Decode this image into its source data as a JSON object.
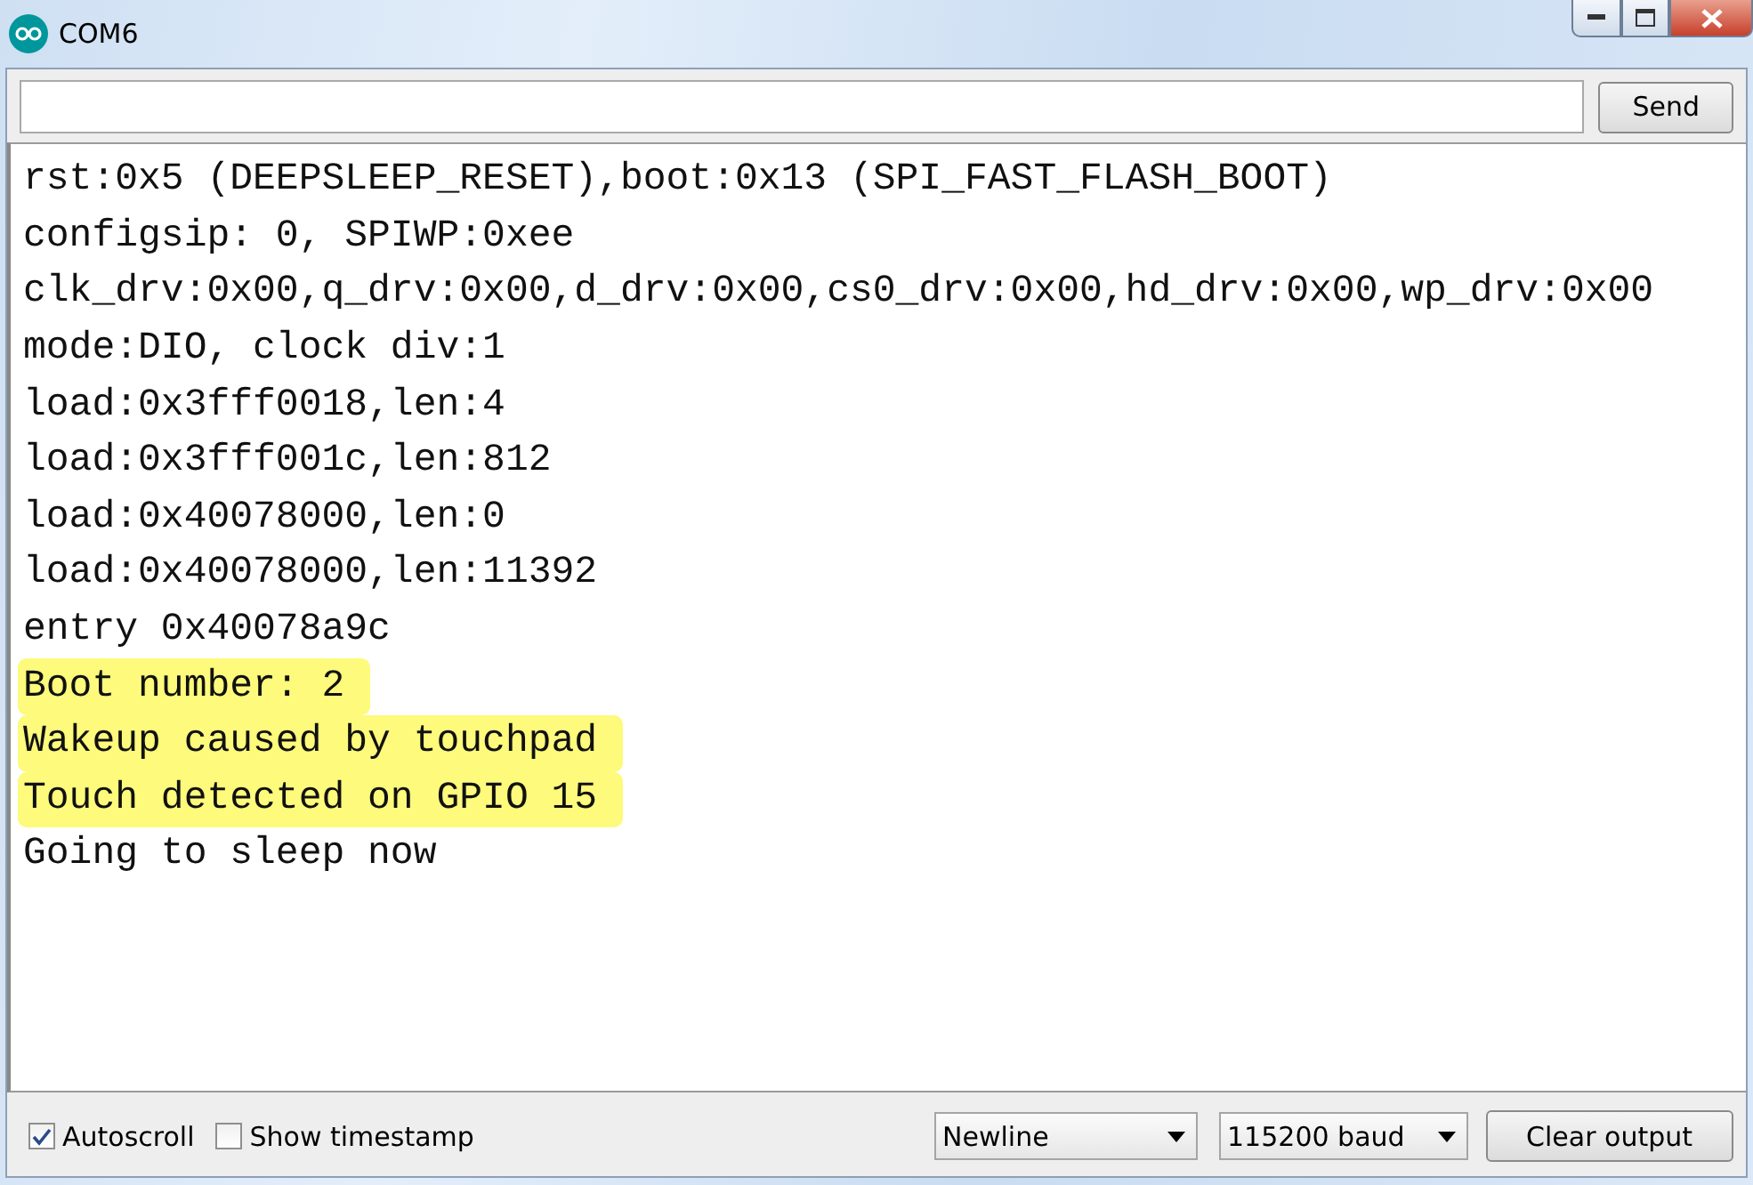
{
  "window": {
    "title": "COM6"
  },
  "send_button": "Send",
  "output": [
    {
      "text": "rst:0x5 (DEEPSLEEP_RESET),boot:0x13 (SPI_FAST_FLASH_BOOT)",
      "highlighted": false
    },
    {
      "text": "configsip: 0, SPIWP:0xee",
      "highlighted": false
    },
    {
      "text": "clk_drv:0x00,q_drv:0x00,d_drv:0x00,cs0_drv:0x00,hd_drv:0x00,wp_drv:0x00",
      "highlighted": false
    },
    {
      "text": "mode:DIO, clock div:1",
      "highlighted": false
    },
    {
      "text": "load:0x3fff0018,len:4",
      "highlighted": false
    },
    {
      "text": "load:0x3fff001c,len:812",
      "highlighted": false
    },
    {
      "text": "load:0x40078000,len:0",
      "highlighted": false
    },
    {
      "text": "load:0x40078000,len:11392",
      "highlighted": false
    },
    {
      "text": "entry 0x40078a9c",
      "highlighted": false
    },
    {
      "text": "Boot number: 2",
      "highlighted": true
    },
    {
      "text": "Wakeup caused by touchpad",
      "highlighted": true
    },
    {
      "text": "Touch detected on GPIO 15",
      "highlighted": true
    },
    {
      "text": "Going to sleep now",
      "highlighted": false
    }
  ],
  "options": [
    {
      "label": "Autoscroll",
      "checked": true
    },
    {
      "label": "Show timestamp",
      "checked": false
    }
  ],
  "line_ending": "Newline",
  "baud_rate": "115200 baud",
  "clear_button": "Clear output"
}
